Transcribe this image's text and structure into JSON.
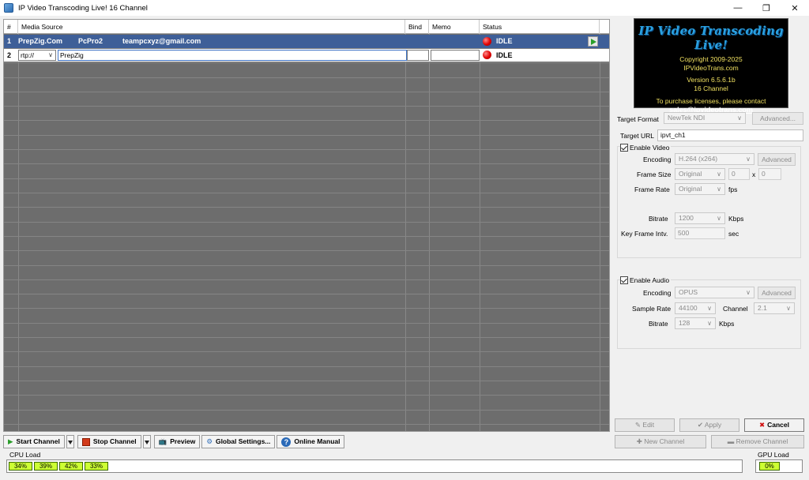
{
  "window": {
    "title": "IP Video Transcoding Live! 16 Channel"
  },
  "grid": {
    "headers": {
      "num": "#",
      "source": "Media Source",
      "bind": "Bind",
      "memo": "Memo",
      "status": "Status"
    },
    "row1": {
      "num": "1",
      "name": "PrepZig.Com",
      "host": "PcPro2",
      "email": "teampcxyz@gmail.com",
      "status": "IDLE"
    },
    "row2": {
      "num": "2",
      "protocol": "rtp://",
      "source_value": "PrepZig",
      "status": "IDLE"
    }
  },
  "logo": {
    "title": "IP Video Transcoding Live!",
    "copyright": "Copyright 2009-2025",
    "site": "IPVideoTrans.com",
    "version": "Version 6.5.6.1b",
    "edition": "16 Channel",
    "purchase": "To purchase licenses, please contact",
    "email": "sales@ipvideotrans.com"
  },
  "settings": {
    "target_format_label": "Target Format",
    "target_format_value": "NewTek NDI",
    "advanced_label": "Advanced...",
    "target_url_label": "Target URL",
    "target_url_value": "ipvt_ch1",
    "video": {
      "enable_label": "Enable Video",
      "encoding_label": "Encoding",
      "encoding_value": "H.264 (x264)",
      "advanced_label": "Advanced",
      "frame_size_label": "Frame Size",
      "frame_size_value": "Original",
      "width_value": "0",
      "x_label": "x",
      "height_value": "0",
      "frame_rate_label": "Frame Rate",
      "frame_rate_value": "Original",
      "fps_label": "fps",
      "bitrate_label": "Bitrate",
      "bitrate_value": "1200",
      "kbps_label": "Kbps",
      "keyframe_label": "Key Frame Intv.",
      "keyframe_value": "500",
      "sec_label": "sec"
    },
    "audio": {
      "enable_label": "Enable Audio",
      "encoding_label": "Encoding",
      "encoding_value": "OPUS",
      "advanced_label": "Advanced",
      "sample_rate_label": "Sample Rate",
      "sample_rate_value": "44100",
      "channel_label": "Channel",
      "channel_value": "2.1",
      "bitrate_label": "Bitrate",
      "bitrate_value": "128",
      "kbps_label": "Kbps"
    }
  },
  "actions": {
    "edit": "Edit",
    "apply": "Apply",
    "cancel": "Cancel",
    "new_channel": "New Channel",
    "remove_channel": "Remove Channel"
  },
  "toolbar": {
    "start": "Start Channel",
    "stop": "Stop Channel",
    "preview": "Preview",
    "global_settings": "Global Settings...",
    "online_manual": "Online Manual"
  },
  "load": {
    "cpu_label": "CPU Load",
    "cpu_values": [
      "34%",
      "39%",
      "42%",
      "33%"
    ],
    "gpu_label": "GPU Load",
    "gpu_value": "0%"
  },
  "colors": {
    "selected_row": "#3e5f98",
    "grid_bg": "#6d6d6d",
    "meter_fill": "#ccff33"
  }
}
